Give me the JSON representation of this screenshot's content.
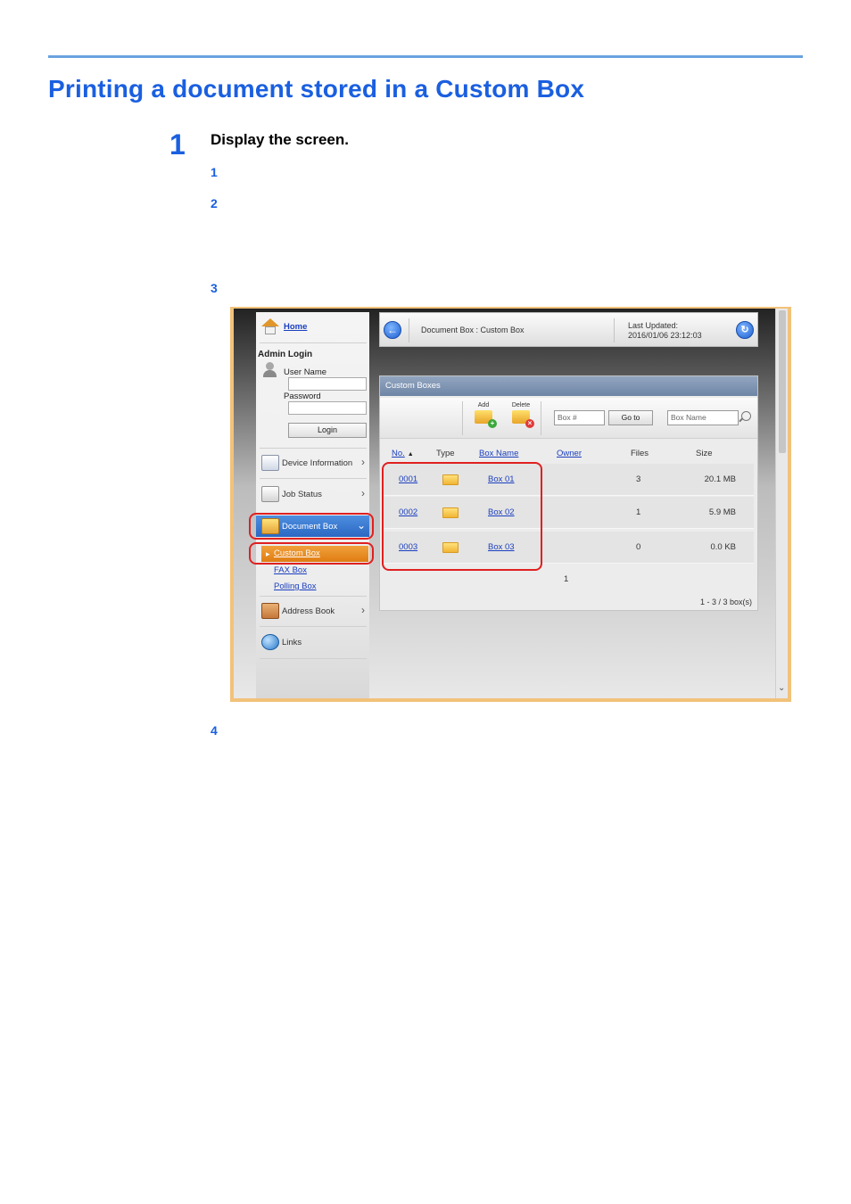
{
  "page": {
    "title": "Printing a document stored in a Custom Box",
    "step": {
      "number": "1",
      "text": "Display the screen."
    },
    "substeps": [
      "1",
      "2",
      "3",
      "4"
    ]
  },
  "left_panel": {
    "home": "Home",
    "admin_login": "Admin Login",
    "user_name_label": "User Name",
    "password_label": "Password",
    "user_name_value": "",
    "password_value": "",
    "login_button": "Login",
    "nav": {
      "device_information": "Device Information",
      "job_status": "Job Status",
      "document_box": "Document Box",
      "custom_box": "Custom Box",
      "fax_box": "FAX Box",
      "polling_box": "Polling Box",
      "address_book": "Address Book",
      "links": "Links"
    }
  },
  "header": {
    "breadcrumb": "Document Box : Custom Box",
    "last_updated_label": "Last Updated:",
    "last_updated_value": "2016/01/06 23:12:03"
  },
  "panel": {
    "title": "Custom Boxes",
    "add_label": "Add",
    "delete_label": "Delete",
    "box_number_placeholder": "Box #",
    "goto_button": "Go to",
    "box_name_placeholder": "Box Name",
    "columns": [
      "No.",
      "Type",
      "Box Name",
      "Owner",
      "Files",
      "Size"
    ],
    "rows": [
      {
        "no": "0001",
        "name": "Box 01",
        "owner": "",
        "files": "3",
        "size": "20.1 MB"
      },
      {
        "no": "0002",
        "name": "Box 02",
        "owner": "",
        "files": "1",
        "size": "5.9 MB"
      },
      {
        "no": "0003",
        "name": "Box 03",
        "owner": "",
        "files": "0",
        "size": "0.0 KB"
      }
    ],
    "page_number": "1",
    "range_text": "1 - 3 / 3 box(s)"
  },
  "colors": {
    "heading_blue": "#1a5fe0",
    "highlight_red": "#e02020",
    "nav_selected_blue": "#2b68c2",
    "nav_selected_orange": "#e07c12"
  }
}
